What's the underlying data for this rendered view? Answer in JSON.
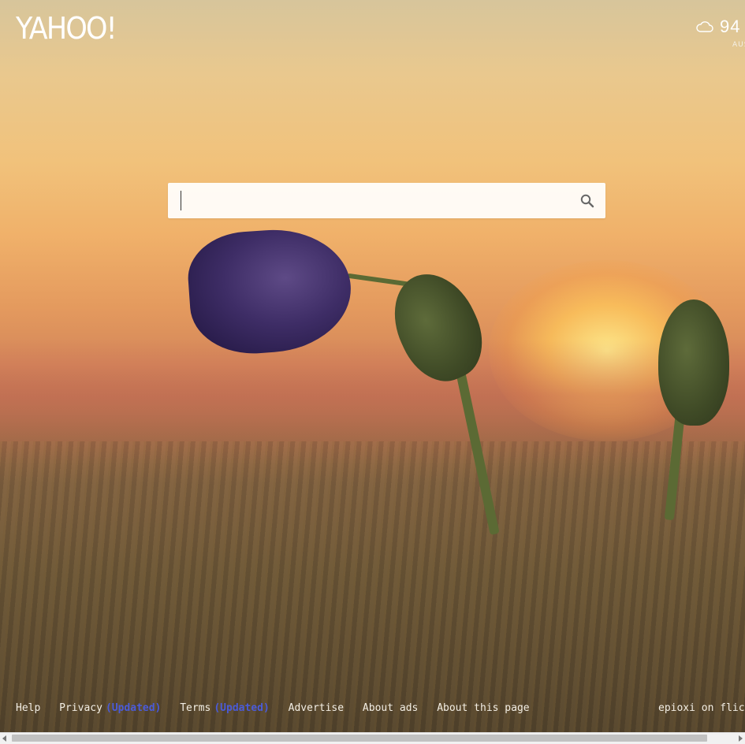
{
  "brand": {
    "logo_text": "YAHOO!"
  },
  "weather": {
    "icon": "cloud-icon",
    "temperature": "94",
    "location": "AUSTIN"
  },
  "search": {
    "value": "",
    "placeholder": "",
    "button_icon": "search-icon"
  },
  "footer": {
    "links": [
      {
        "label": "Help",
        "badge": ""
      },
      {
        "label": "Privacy",
        "badge": "(Updated)"
      },
      {
        "label": "Terms",
        "badge": "(Updated)"
      },
      {
        "label": "Advertise",
        "badge": ""
      },
      {
        "label": "About ads",
        "badge": ""
      },
      {
        "label": "About this page",
        "badge": ""
      }
    ],
    "photo_credit": "epioxi on flickr"
  },
  "colors": {
    "updated_badge": "#4a5bd8",
    "footer_text": "#f3eee4"
  }
}
